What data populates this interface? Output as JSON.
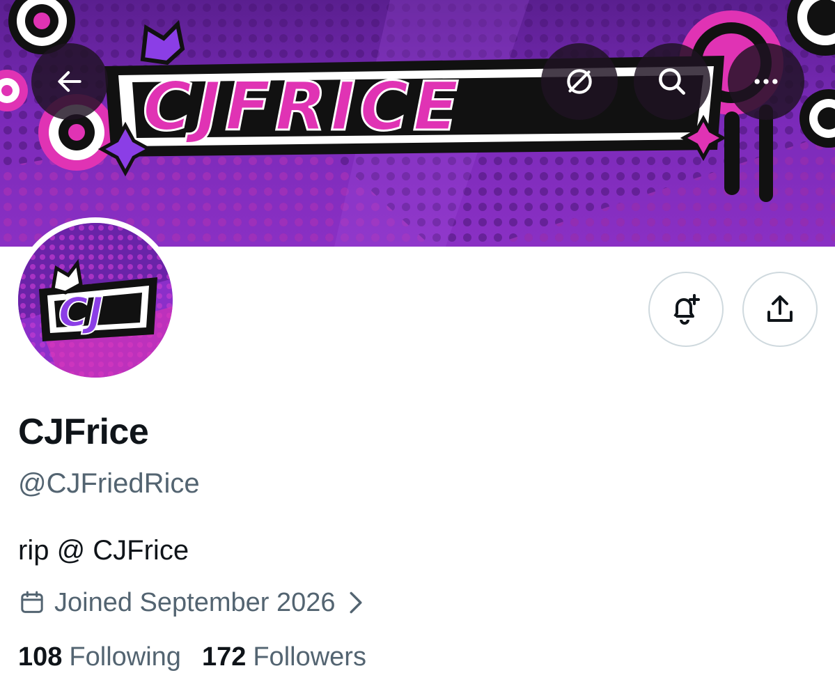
{
  "banner": {
    "logo_text": "CJFRICE",
    "colors": {
      "bg_dark": "#5a1f8f",
      "bg_light": "#8a30c4",
      "pink": "#e033b4",
      "purple": "#8b3ee6",
      "ink": "#111111"
    }
  },
  "nav": {
    "back_icon": "arrow-left-icon",
    "translate_icon": "no-translate-icon",
    "search_icon": "search-icon",
    "more_icon": "more-horizontal-icon"
  },
  "avatar": {
    "logo_text": "CJ"
  },
  "actions": {
    "notify_icon": "bell-plus-icon",
    "share_icon": "share-upload-icon"
  },
  "profile": {
    "display_name": "CJFrice",
    "handle": "@CJFriedRice",
    "bio": "rip @ CJFrice",
    "joined": "Joined September 2026",
    "following_count": "108",
    "following_label": "Following",
    "followers_count": "172",
    "followers_label": "Followers"
  }
}
